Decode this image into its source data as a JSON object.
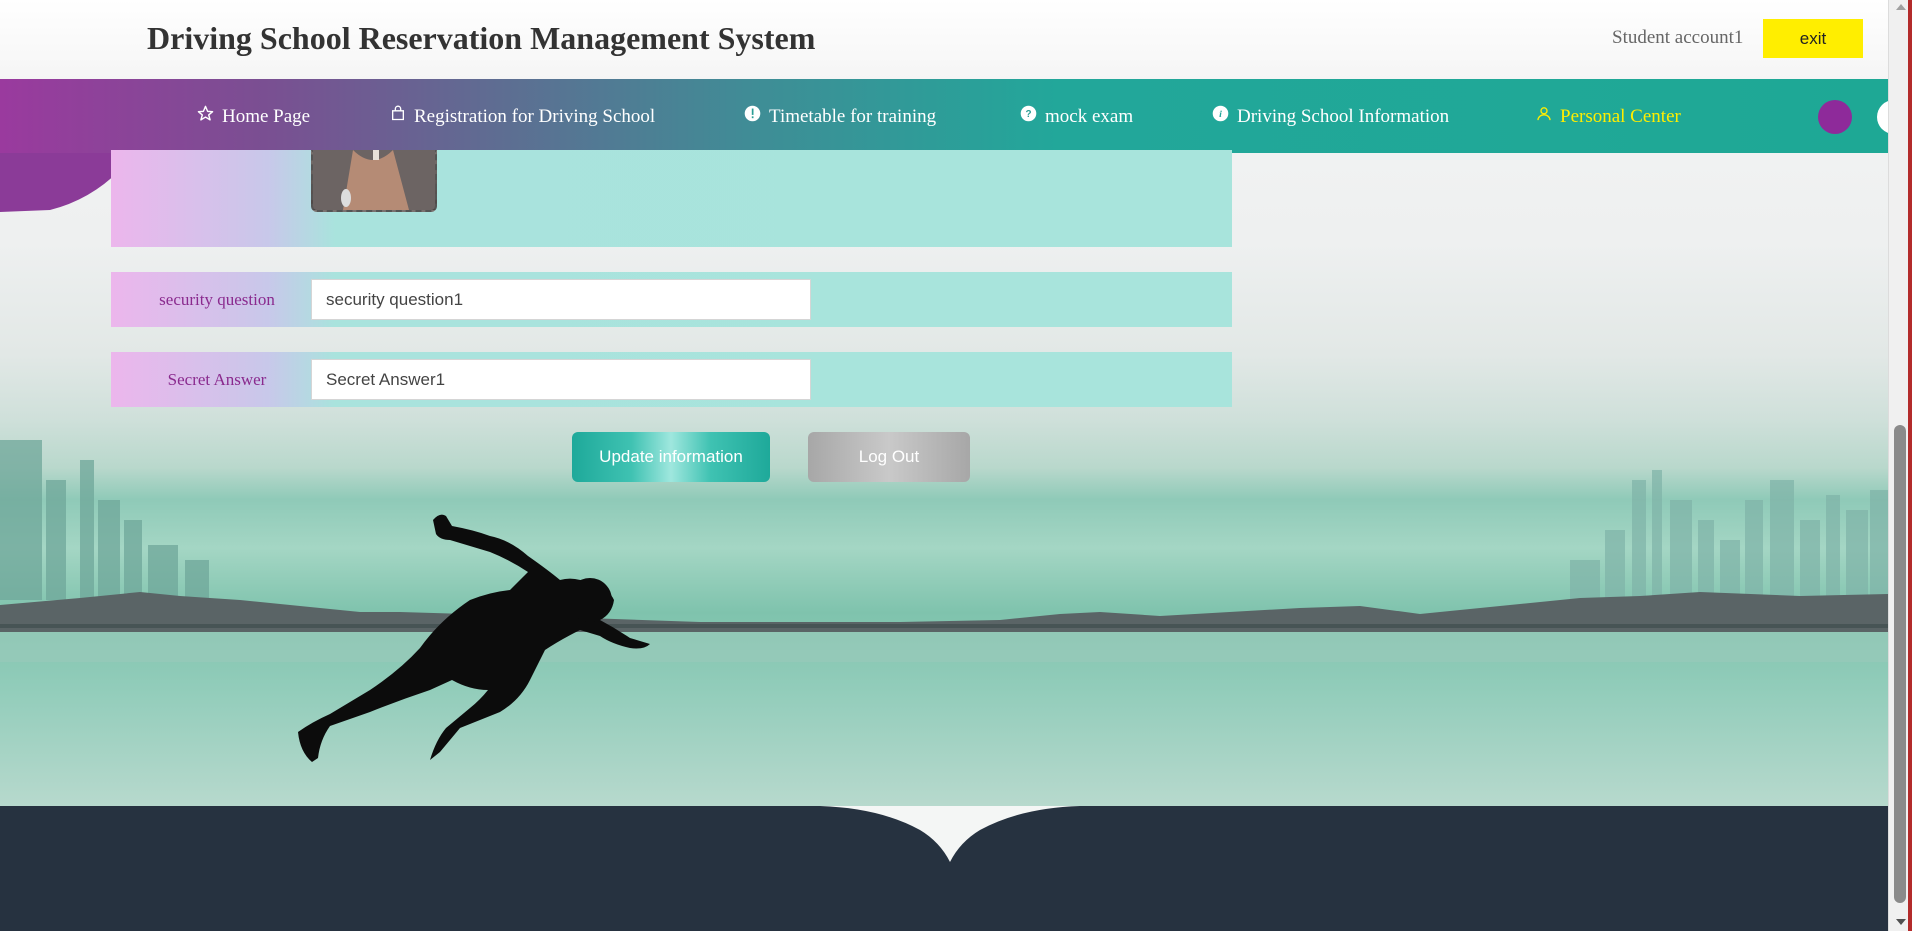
{
  "header": {
    "title": "Driving School Reservation Management System",
    "account": "Student account1",
    "exit_label": "exit"
  },
  "nav": {
    "items": [
      {
        "label": "Home Page",
        "icon": "star-icon"
      },
      {
        "label": "Registration for Driving School",
        "icon": "bag-icon"
      },
      {
        "label": "Timetable for training",
        "icon": "exclamation-circle-icon"
      },
      {
        "label": "mock exam",
        "icon": "question-circle-icon"
      },
      {
        "label": "Driving School Information",
        "icon": "info-circle-icon"
      },
      {
        "label": "Personal Center",
        "icon": "user-icon",
        "active": true
      }
    ]
  },
  "form": {
    "security_question_label": "security question",
    "security_question_value": "security question1",
    "secret_answer_label": "Secret Answer",
    "secret_answer_value": "Secret Answer1"
  },
  "buttons": {
    "update_label": "Update information",
    "logout_label": "Log Out"
  },
  "colors": {
    "nav_start": "#9a3a9e",
    "nav_end": "#1ea895",
    "active_nav": "#ffee00",
    "exit_button": "#ffee00",
    "label_text": "#8a2a8e",
    "footer": "#263240"
  }
}
